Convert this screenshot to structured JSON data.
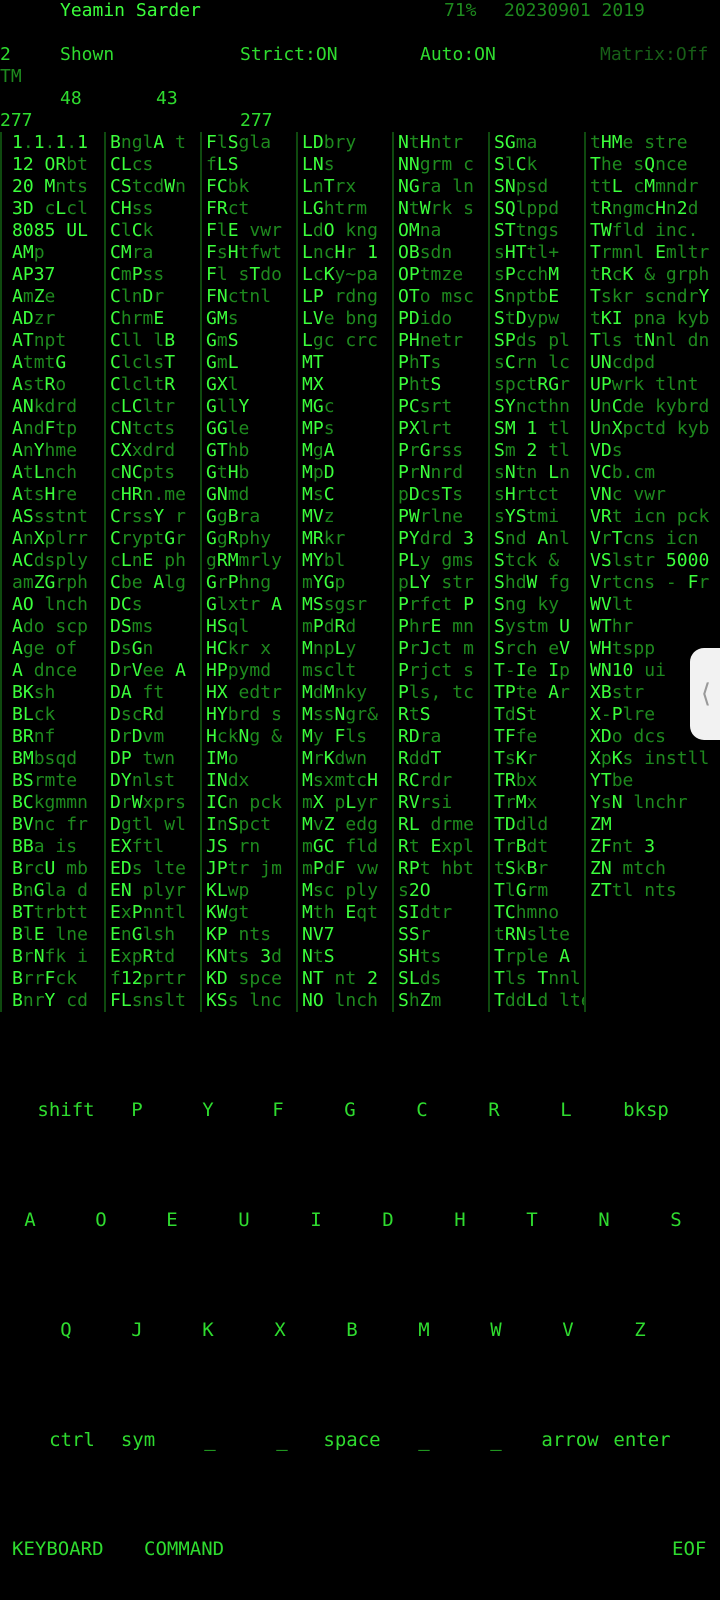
{
  "header": {
    "name": "Yeamin Sarder",
    "battery": "71%",
    "datetime": "20230901 2019"
  },
  "status": {
    "count": "2",
    "shown": "Shown",
    "strict": "Strict:ON",
    "auto": "Auto:ON",
    "matrix": "Matrix:Off",
    "tm": "TM"
  },
  "numbers": {
    "a": "48",
    "b": "43",
    "c": "277",
    "d": "277"
  },
  "grid_rows": [
    [
      "1.1.1.1",
      "BnglA t",
      "FlSgla",
      "LDbry",
      "NtHntr",
      "SGma",
      "tHMe stre"
    ],
    [
      "12 ORbt",
      "CLcs",
      "fLS",
      "LNs",
      "NNgrm c",
      "SlCk",
      "The sQnce"
    ],
    [
      "20 Mnts",
      "CStcdWn",
      "FCbk",
      "LnTrx",
      "NGra ln",
      "SNpsd",
      "ttL cMmndr"
    ],
    [
      "3D cLcl",
      "CHss",
      "FRct",
      "LGhtrm",
      "NtWrk s",
      "SQlppd",
      "tRngmcHn2d"
    ],
    [
      "8085 UL",
      "ClCk",
      "FlE vwr",
      "LdO kng",
      "OMna",
      "STtngs",
      "TWfld inc."
    ],
    [
      "AMp",
      "CMra",
      "FsHtfwt",
      "LncHr 1",
      "OBsdn",
      "sHTtl+",
      "Trmnl Emltr"
    ],
    [
      "AP37",
      "CmPss",
      "Fl sTdo",
      "LcKy~pa",
      "OPtmze",
      "sPcchM",
      "tRcK & grph"
    ],
    [
      "AmZe",
      "ClnDr",
      "FNctnl",
      "LP rdng",
      "OTo msc",
      "SnptbE",
      "Tskr scndrY"
    ],
    [
      "ADzr",
      "ChrmE",
      "GMs",
      "LVe bng",
      "PDido",
      "StDypw",
      "tKI pna kyb"
    ],
    [
      "ATnpt",
      "Cll lB",
      "GmS",
      "Lgc crc",
      "PHnetr",
      "SPds pl",
      "Tls tNnl dn"
    ],
    [
      "AtmtG",
      "ClclsT",
      "GmL",
      "MT",
      "PhTs",
      "sCrn lc",
      "UNcdpd"
    ],
    [
      "AstRo",
      "ClcltR",
      "GXl",
      "MX",
      "PhtS",
      "spctRGr",
      "UPwrk tlnt"
    ],
    [
      "ANkdrd",
      "cLCltr",
      "GllY",
      "MGc",
      "PCsrt",
      "SYncthn",
      "UnCde kybrd"
    ],
    [
      "AndFtp",
      "CNtcts",
      "GGle",
      "MPs",
      "PXlrt",
      "SM 1 tl",
      "UnXpctd kyb"
    ],
    [
      "AnYhme",
      "CXxdrd",
      "GThb",
      "MgA",
      "PrGrss",
      "Sm 2 tl",
      "VDs"
    ],
    [
      "AtLnch",
      "cNCpts",
      "GtHb",
      "MpD",
      "PrNnrd",
      "sNtn Ln",
      "VCb.cm"
    ],
    [
      "AtsHre",
      "cHRn.me",
      "GNmd",
      "MsC",
      "pDcsTs",
      "sHrtct",
      "VNc vwr"
    ],
    [
      "ASsstnt",
      "CrssY r",
      "GgBra",
      "MVz",
      "PWrlne",
      "sYStmi",
      "VRt icn pck"
    ],
    [
      "AnXplrr",
      "CryptGr",
      "GgRphy",
      "MRkr",
      "PYdrd 3",
      "Snd Anl",
      "VrTcns icn"
    ],
    [
      "ACdsply",
      "cLnE ph",
      "gRMmrly",
      "MYbl",
      "PLy gms",
      "Stck &",
      "VSlstr 5000"
    ],
    [
      "amZGrph",
      "Cbe Alg",
      "GrPhng",
      "mYGp",
      "pLY str",
      "ShdW fg",
      "Vrtcns - Fr"
    ],
    [
      "AO lnch",
      "DCs",
      "Glxtr A",
      "MSsgsr",
      "Prfct P",
      "Sng ky",
      "WVlt"
    ],
    [
      "Ado scp",
      "DSms",
      "HSql",
      "mPdRd",
      "PhrE mn",
      "Systm U",
      "WThr"
    ],
    [
      "Age of",
      "DsGn",
      "HCkr x",
      "MnpLy",
      "PrJct m",
      "Srch eV",
      "WHtspp"
    ],
    [
      "A dnce",
      "DrVee A",
      "HPpymd",
      "msclt",
      "Prjct s",
      "T-Ie Ip",
      "WN10 ui"
    ],
    [
      "BKsh",
      "DA ft",
      "HX edtr",
      "MdMnky",
      "Pls, tc",
      "TPte Ar",
      "XBstr"
    ],
    [
      "BLck",
      "DscRd",
      "HYbrd s",
      "MssNgr&",
      "RtS",
      "TdSt",
      "X-Plre"
    ],
    [
      "BRnf",
      "DrDvm",
      "HckNg &",
      "My Fls",
      "RDra",
      "TFfe",
      "XDo dcs"
    ],
    [
      "BMbsqd",
      "DP twn",
      "IMo",
      "MrKdwn",
      "RddT",
      "TsKr",
      "XpKs instll"
    ],
    [
      "BSrmte",
      "DYnlst",
      "INdx",
      "MsxmtcH",
      "RCrdr",
      "TRbx",
      "YTbe"
    ],
    [
      "BCkgmmn",
      "DrWxprs",
      "ICn pck",
      "mX pLyr",
      "RVrsi",
      "TrMx",
      "YsN lnchr"
    ],
    [
      "BVnc fr",
      "Dgtl wl",
      "InSpct",
      "MvZ edg",
      "RL drme",
      "TDdld",
      "ZM"
    ],
    [
      "BBa is",
      "EXftl",
      "JS rn",
      "mGC fld",
      "Rt Expl",
      "TrBdt",
      "ZFnt 3"
    ],
    [
      "BrcU mb",
      "EDs lte",
      "JPtr jm",
      "mPdF vw",
      "RPt hbt",
      "tSkBr",
      "ZN mtch"
    ],
    [
      "BnGla d",
      "EN plyr",
      "KLwp",
      "Msc ply",
      "s2O",
      "TlGrm",
      "ZTtl nts"
    ],
    [
      "BTtrbtt",
      "ExPnntl",
      "KWgt",
      "Mth Eqt",
      "SIdtr",
      "TChmno",
      ""
    ],
    [
      "BlE lne",
      "EnGlsh",
      "KP nts",
      "NV7",
      "SSr",
      "tRNslte",
      ""
    ],
    [
      "BrNfk i",
      "ExpRtd",
      "KNts 3d",
      "NtS",
      "SHts",
      "Trple A",
      ""
    ],
    [
      "BrrFck",
      "f12prtr",
      "KD spce",
      "NT nt 2",
      "SLds",
      "Tls Tnnl",
      ""
    ],
    [
      "BnrY cd",
      "FLsnslt",
      "KSs lnc",
      "NO lnch",
      "ShZm",
      "TddLd lte",
      ""
    ]
  ],
  "keyboard": {
    "row1": [
      "shift",
      "P",
      "Y",
      "F",
      "G",
      "C",
      "R",
      "L",
      "bksp"
    ],
    "row2": [
      "A",
      "O",
      "E",
      "U",
      "I",
      "D",
      "H",
      "T",
      "N",
      "S"
    ],
    "row3": [
      "Q",
      "J",
      "K",
      "X",
      "B",
      "M",
      "W",
      "V",
      "Z"
    ],
    "row4": [
      "ctrl",
      "sym",
      "_",
      "_",
      "space",
      "_",
      "_",
      "arrow",
      "enter"
    ]
  },
  "bottom": {
    "keyboard": "KEYBOARD",
    "command": "COMMAND",
    "eof": "EOF"
  },
  "side_handle_icon": "chevron-left-icon",
  "colors": {
    "background": "#000000",
    "text": "#2fdc2f",
    "dim": "#1e8a1e"
  }
}
